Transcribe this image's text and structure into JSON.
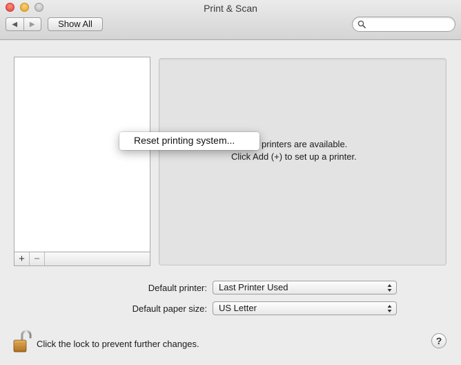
{
  "window": {
    "title": "Print & Scan"
  },
  "toolbar": {
    "back_glyph": "◀",
    "forward_glyph": "▶",
    "show_all_label": "Show All",
    "search": {
      "value": "",
      "placeholder": ""
    }
  },
  "printer_list": {
    "items": [],
    "add_label": "+",
    "remove_label": "−"
  },
  "detail": {
    "message_line1": "printers are available.",
    "message_line2": "Click Add (+) to set up a printer."
  },
  "context_menu": {
    "items": [
      {
        "label": "Reset printing system..."
      }
    ]
  },
  "settings": {
    "default_printer_label": "Default printer:",
    "default_printer_value": "Last Printer Used",
    "default_paper_label": "Default paper size:",
    "default_paper_value": "US Letter"
  },
  "footer": {
    "lock_text": "Click the lock to prevent further changes.",
    "help_label": "?"
  },
  "icons": {
    "close": "close-icon",
    "minimize": "minimize-icon",
    "zoom": "zoom-icon",
    "search": "magnifier-icon",
    "lock": "lock-open-icon",
    "popup_arrows": "updown-arrows-icon"
  },
  "colors": {
    "close": "#e0443e",
    "minimize": "#dea123",
    "zoom": "#b5b5b5",
    "window_bg": "#ececec",
    "detail_bg": "#e3e3e3"
  }
}
